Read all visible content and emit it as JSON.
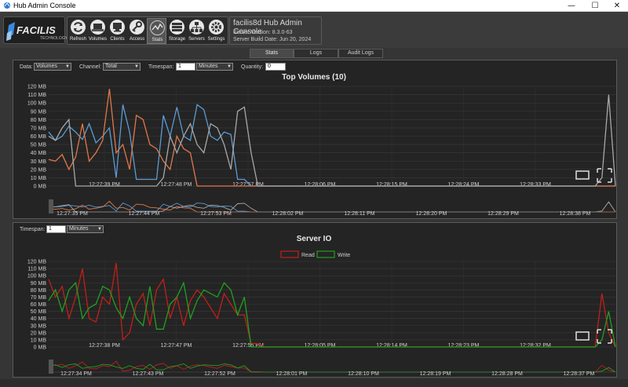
{
  "window": {
    "title": "Hub Admin Console"
  },
  "logo": {
    "brand": "FACILIS",
    "sub": "TECHNOLOGY"
  },
  "toolbar": {
    "items": [
      {
        "label": "Refresh",
        "icon": "refresh-icon"
      },
      {
        "label": "Volumes",
        "icon": "volumes-icon"
      },
      {
        "label": "Clients",
        "icon": "clients-icon"
      },
      {
        "label": "Access",
        "icon": "key-icon"
      },
      {
        "label": "Stats",
        "icon": "stats-icon"
      },
      {
        "label": "Storage",
        "icon": "storage-icon"
      },
      {
        "label": "Servers",
        "icon": "servers-icon"
      },
      {
        "label": "Settings",
        "icon": "gear-icon"
      }
    ]
  },
  "server_info": {
    "title": "facilis8d Hub Admin Console",
    "version": "Server Version: 8.3.0-63",
    "build": "Server Build Date: Jun 20, 2024"
  },
  "tabs": [
    "Stats",
    "Logs",
    "Audit Logs"
  ],
  "volumes_panel": {
    "data_label": "Data:",
    "data_value": "Volumes",
    "channel_label": "Channel:",
    "channel_value": "Total",
    "timespan_label": "Timespan:",
    "timespan_value": "1",
    "timespan_unit": "Minutes",
    "quantity_label": "Quantity:",
    "quantity_value": "0"
  },
  "io_panel": {
    "timespan_label": "Timespan:",
    "timespan_value": "1",
    "timespan_unit": "Minutes"
  },
  "colors": {
    "blue": "#5b9bd5",
    "orange": "#e0774a",
    "gray": "#a8a8a8",
    "read": "#c0201a",
    "write": "#20a020"
  },
  "chart_data": [
    {
      "type": "line",
      "title": "Top Volumes (10)",
      "y_ticks": [
        "120 MB",
        "110 MB",
        "100 MB",
        "90 MB",
        "80 MB",
        "70 MB",
        "60 MB",
        "50 MB",
        "40 MB",
        "30 MB",
        "20 MB",
        "10 MB",
        "0 MB"
      ],
      "ylim": [
        0,
        120
      ],
      "x_ticks": [
        "12:27:39 PM",
        "12:27:48 PM",
        "12:27:57 PM",
        "12:28:06 PM",
        "12:28:15 PM",
        "12:28:24 PM",
        "12:28:33 PM"
      ],
      "nav_x_ticks": [
        "12:27:35 PM",
        "12:27:44 PM",
        "12:27:53 PM",
        "12:28:02 PM",
        "12:28:11 PM",
        "12:28:20 PM",
        "12:28:29 PM",
        "12:28:38 PM"
      ],
      "series": [
        {
          "color": "blue",
          "values": [
            65,
            55,
            60,
            72,
            65,
            56,
            75,
            52,
            60,
            70,
            10,
            98,
            65,
            8,
            8,
            8,
            8,
            85,
            60,
            95,
            60,
            55,
            98,
            92,
            60,
            55,
            65,
            62,
            8,
            8,
            0,
            0,
            0,
            0,
            0,
            0,
            0,
            0,
            0,
            0,
            0,
            0,
            0,
            0,
            0,
            0,
            0,
            0,
            0,
            0,
            0,
            0,
            0,
            0,
            0,
            0,
            0,
            0,
            0,
            0,
            0,
            0,
            0,
            0,
            0,
            0,
            0,
            0,
            0,
            0,
            0,
            0,
            0,
            0,
            0,
            0,
            0,
            0,
            0,
            0,
            0,
            0,
            0,
            0,
            0
          ]
        },
        {
          "color": "orange",
          "values": [
            32,
            30,
            38,
            20,
            35,
            75,
            30,
            40,
            55,
            117,
            40,
            50,
            20,
            85,
            80,
            50,
            45,
            30,
            20,
            60,
            45,
            40,
            0,
            0,
            0,
            0,
            0,
            0,
            0,
            0,
            0,
            0,
            0,
            0,
            0,
            0,
            0,
            0,
            0,
            0,
            0,
            0,
            0,
            0,
            0,
            0,
            0,
            0,
            0,
            0,
            0,
            0,
            0,
            0,
            0,
            0,
            0,
            0,
            0,
            0,
            0,
            0,
            0,
            0,
            0,
            0,
            0,
            0,
            0,
            0,
            0,
            0,
            0,
            0,
            0,
            0,
            0,
            0,
            0,
            0,
            0,
            0,
            0,
            0,
            0
          ]
        },
        {
          "color": "gray",
          "values": [
            60,
            55,
            70,
            80,
            0,
            0,
            0,
            0,
            0,
            0,
            0,
            0,
            0,
            0,
            0,
            0,
            0,
            10,
            60,
            40,
            60,
            75,
            50,
            40,
            75,
            70,
            50,
            20,
            90,
            95,
            40,
            0,
            0,
            0,
            0,
            0,
            0,
            0,
            0,
            0,
            0,
            0,
            0,
            0,
            0,
            0,
            0,
            0,
            0,
            0,
            0,
            0,
            0,
            0,
            0,
            0,
            0,
            0,
            0,
            0,
            0,
            0,
            0,
            0,
            0,
            0,
            0,
            0,
            0,
            0,
            0,
            0,
            0,
            0,
            0,
            0,
            0,
            0,
            0,
            0,
            0,
            0,
            10,
            110,
            0
          ]
        }
      ]
    },
    {
      "type": "line",
      "title": "Server IO",
      "legend": [
        "Read",
        "Write"
      ],
      "legend_position": "top-center",
      "y_ticks": [
        "120 MB",
        "110 MB",
        "100 MB",
        "90 MB",
        "80 MB",
        "70 MB",
        "60 MB",
        "50 MB",
        "40 MB",
        "30 MB",
        "20 MB",
        "10 MB",
        "0 MB"
      ],
      "ylim": [
        0,
        120
      ],
      "x_ticks": [
        "12:27:38 PM",
        "12:27:47 PM",
        "12:27:56 PM",
        "12:28:05 PM",
        "12:28:14 PM",
        "12:28:23 PM",
        "12:28:32 PM"
      ],
      "nav_x_ticks": [
        "12:27:34 PM",
        "12:27:43 PM",
        "12:27:52 PM",
        "12:28:01 PM",
        "12:28:10 PM",
        "12:28:19 PM",
        "12:28:28 PM",
        "12:28:37 PM"
      ],
      "series": [
        {
          "name": "Read",
          "color": "read",
          "values": [
            95,
            70,
            85,
            40,
            70,
            110,
            40,
            35,
            70,
            60,
            118,
            10,
            20,
            60,
            75,
            30,
            80,
            95,
            40,
            70,
            30,
            65,
            80,
            70,
            55,
            40,
            75,
            60,
            45,
            45,
            5,
            5,
            0,
            0,
            0,
            0,
            0,
            0,
            0,
            0,
            0,
            0,
            0,
            0,
            0,
            0,
            0,
            0,
            0,
            0,
            0,
            0,
            0,
            0,
            0,
            0,
            0,
            0,
            0,
            0,
            0,
            0,
            0,
            0,
            0,
            0,
            0,
            0,
            0,
            0,
            0,
            0,
            0,
            0,
            0,
            0,
            0,
            0,
            0,
            0,
            0,
            0,
            75,
            20,
            0
          ]
        },
        {
          "name": "Write",
          "color": "write",
          "values": [
            65,
            80,
            50,
            80,
            90,
            40,
            55,
            60,
            85,
            80,
            55,
            40,
            70,
            40,
            30,
            85,
            25,
            25,
            60,
            70,
            90,
            40,
            65,
            80,
            75,
            70,
            90,
            80,
            45,
            70,
            0,
            0,
            0,
            0,
            0,
            0,
            0,
            0,
            0,
            0,
            0,
            0,
            0,
            0,
            0,
            0,
            0,
            0,
            0,
            0,
            0,
            0,
            0,
            0,
            0,
            0,
            0,
            0,
            0,
            0,
            0,
            0,
            0,
            0,
            0,
            0,
            0,
            0,
            0,
            0,
            0,
            0,
            0,
            0,
            0,
            0,
            0,
            0,
            0,
            0,
            0,
            0,
            10,
            50,
            0
          ]
        }
      ]
    }
  ]
}
